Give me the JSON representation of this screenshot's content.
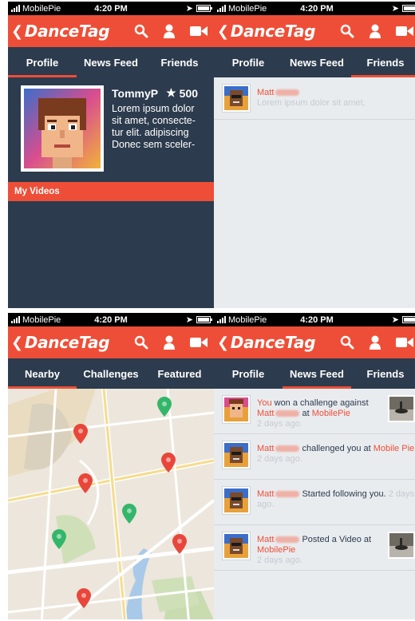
{
  "status": {
    "carrier": "MobilePie",
    "time": "4:20 PM"
  },
  "app": {
    "brand": "DanceTag"
  },
  "colors": {
    "accent": "#ee4e37",
    "navy": "#2c3b4d",
    "bg": "#e9ecef"
  },
  "icons": {
    "back": "chevron-left",
    "search": "search-icon",
    "profile": "person-icon",
    "video": "video-camera-icon",
    "star": "star-icon"
  },
  "screens": {
    "profile": {
      "tabs": [
        "Profile",
        "News Feed",
        "Friends"
      ],
      "active_tab": "Profile",
      "username": "TommyP",
      "points": "500",
      "bio": "Lorem ipsum dolor sit amet, consecte-tur elit. adipiscing Donec sem sceler-",
      "section_title": "My Videos"
    },
    "friends": {
      "tabs": [
        "Profile",
        "News Feed",
        "Friends"
      ],
      "active_tab": "Friends",
      "items": [
        {
          "name": "Matt",
          "text": "Lorem ipsum dolor sit amet,"
        }
      ]
    },
    "nearby": {
      "tabs": [
        "Nearby",
        "Challenges",
        "Featured"
      ],
      "active_tab": "Nearby",
      "pins": [
        {
          "color": "green"
        },
        {
          "color": "red"
        },
        {
          "color": "red"
        },
        {
          "color": "red"
        },
        {
          "color": "green"
        },
        {
          "color": "green"
        },
        {
          "color": "red"
        },
        {
          "color": "red"
        }
      ]
    },
    "newsfeed": {
      "tabs": [
        "Profile",
        "News Feed",
        "Friends"
      ],
      "active_tab": "News Feed",
      "items": [
        {
          "actor": "You",
          "text": "won a challenge against",
          "target": "Matt",
          "mid": "at",
          "place": "MobilePie",
          "time": "2 days ago."
        },
        {
          "actor": "Matt",
          "text": "challenged you at",
          "place": "Mobile Pie",
          "time": "2 days ago."
        },
        {
          "actor": "Matt",
          "text": "Started following you.",
          "time": "2 days ago."
        },
        {
          "actor": "Matt",
          "text": "Posted a Video at",
          "place": "MobilePie",
          "time": "2 days ago."
        }
      ]
    }
  }
}
